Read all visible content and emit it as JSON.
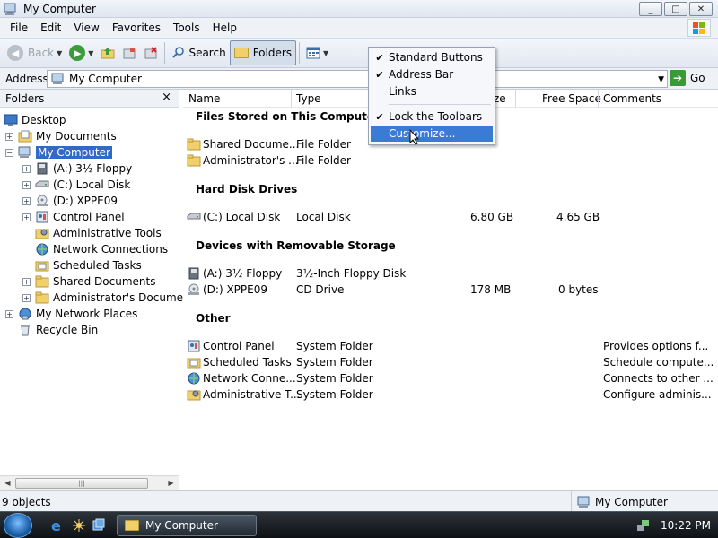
{
  "window": {
    "title": "My Computer",
    "buttons": [
      "_",
      "□",
      "✕"
    ]
  },
  "menubar": {
    "items": [
      "File",
      "Edit",
      "View",
      "Favorites",
      "Tools",
      "Help"
    ]
  },
  "toolbar": {
    "back_label": "Back",
    "search_label": "Search",
    "folders_label": "Folders"
  },
  "addressbar": {
    "label": "Address",
    "value": "My Computer",
    "go_label": "Go"
  },
  "folders_pane": {
    "title": "Folders",
    "close_glyph": "×",
    "tree": [
      {
        "label": "Desktop",
        "icon": "desktop-icon"
      },
      {
        "label": "My Documents",
        "icon": "my-documents-icon"
      },
      {
        "label": "My Computer",
        "icon": "my-computer-icon",
        "selected": true
      },
      {
        "label": "(A:) 3½ Floppy",
        "icon": "floppy-icon"
      },
      {
        "label": "(C:) Local Disk",
        "icon": "hard-disk-icon"
      },
      {
        "label": "(D:) XPPE09",
        "icon": "cd-drive-icon"
      },
      {
        "label": "Control Panel",
        "icon": "control-panel-icon"
      },
      {
        "label": "Administrative Tools",
        "icon": "administrative-tools-icon"
      },
      {
        "label": "Network Connections",
        "icon": "network-connections-icon"
      },
      {
        "label": "Scheduled Tasks",
        "icon": "scheduled-tasks-icon"
      },
      {
        "label": "Shared Documents",
        "icon": "folder-icon"
      },
      {
        "label": "Administrator's Documer",
        "icon": "folder-icon"
      },
      {
        "label": "My Network Places",
        "icon": "network-places-icon"
      },
      {
        "label": "Recycle Bin",
        "icon": "recycle-bin-icon"
      }
    ]
  },
  "columns": {
    "name": "Name",
    "type": "Type",
    "size": "ze",
    "free_space": "Free Space",
    "comments": "Comments"
  },
  "groups": {
    "files_stored": "Files Stored on This Computer",
    "hard_disk": "Hard Disk Drives",
    "removable": "Devices with Removable Storage",
    "other": "Other"
  },
  "rows": {
    "shared_docs": {
      "name": "Shared Docume...",
      "type": "File Folder"
    },
    "admin_docs": {
      "name": "Administrator's ...",
      "type": "File Folder"
    },
    "c_disk": {
      "name": "(C:) Local Disk",
      "type": "Local Disk",
      "size": "6.80 GB",
      "free": "4.65 GB"
    },
    "floppy": {
      "name": "(A:) 3½ Floppy",
      "type": "3½-Inch Floppy Disk"
    },
    "d_drive": {
      "name": "(D:) XPPE09",
      "type": "CD Drive",
      "size": "178 MB",
      "free": "0 bytes"
    },
    "control_panel": {
      "name": "Control Panel",
      "type": "System Folder",
      "comment": "Provides options f..."
    },
    "scheduled_tasks": {
      "name": "Scheduled Tasks",
      "type": "System Folder",
      "comment": "Schedule compute..."
    },
    "network_conn": {
      "name": "Network Conne...",
      "type": "System Folder",
      "comment": "Connects to other ..."
    },
    "admin_tools": {
      "name": "Administrative T...",
      "type": "System Folder",
      "comment": "Configure adminis..."
    }
  },
  "context_menu": {
    "standard_buttons": "Standard Buttons",
    "address_bar": "Address Bar",
    "links": "Links",
    "lock_toolbars": "Lock the Toolbars",
    "customize": "Customize...",
    "check_glyph": "✔"
  },
  "statusbar": {
    "objects": "9 objects",
    "location": "My Computer"
  },
  "taskbar": {
    "window_button": "My Computer",
    "clock": "10:22 PM"
  },
  "colors": {
    "selection": "#3169c6",
    "menu_highlight": "#3b7bd6",
    "taskbar": "#1a1f25"
  }
}
